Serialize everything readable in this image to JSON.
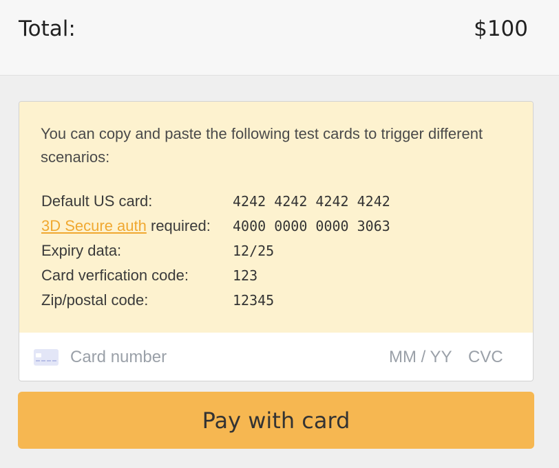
{
  "summary": {
    "total_label": "Total:",
    "total_amount": "$100"
  },
  "notice": {
    "intro": "You can copy and paste the following test cards to trigger different scenarios:",
    "rows": [
      {
        "label": "Default US card:",
        "value": "4242 4242 4242 4242"
      },
      {
        "label_link": "3D Secure auth",
        "label_rest": " required:",
        "value": "4000 0000 0000 3063"
      },
      {
        "label": "Expiry data:",
        "value": "12/25"
      },
      {
        "label": "Card verfication code:",
        "value": "123"
      },
      {
        "label": "Zip/postal code:",
        "value": "12345"
      }
    ]
  },
  "card_field": {
    "icon": "credit-card-icon",
    "number_placeholder": "Card number",
    "expiry_placeholder": "MM / YY",
    "cvc_placeholder": "CVC"
  },
  "pay_button": {
    "label": "Pay with card"
  },
  "colors": {
    "notice_bg": "#fdf2cf",
    "link": "#f0a830",
    "button": "#f6b751"
  }
}
